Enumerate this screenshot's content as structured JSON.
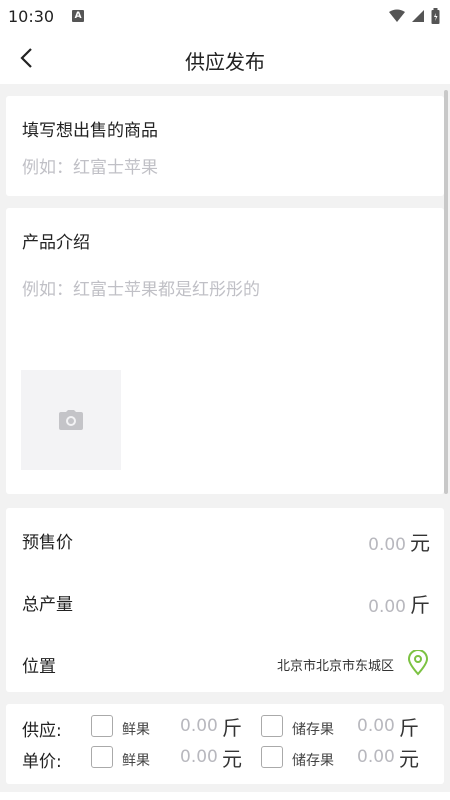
{
  "status": {
    "time": "10:30",
    "notif_letter": "A"
  },
  "nav": {
    "title": "供应发布"
  },
  "product": {
    "name_label": "填写想出售的商品",
    "name_placeholder": "例如：红富士苹果",
    "intro_label": "产品介绍",
    "intro_placeholder": "例如：红富士苹果都是红彤彤的"
  },
  "pricing": {
    "presale_label": "预售价",
    "presale_value": "0.00",
    "presale_unit": "元",
    "output_label": "总产量",
    "output_value": "0.00",
    "output_unit": "斤",
    "location_label": "位置",
    "location_value": "北京市北京市东城区"
  },
  "supply": {
    "supply_label": "供应:",
    "price_label": "单价:",
    "fresh_label": "鲜果",
    "stored_label": "储存果",
    "fresh_supply_value": "0.00",
    "fresh_supply_unit": "斤",
    "stored_supply_value": "0.00",
    "stored_supply_unit": "斤",
    "fresh_price_value": "0.00",
    "fresh_price_unit": "元",
    "stored_price_value": "0.00",
    "stored_price_unit": "元"
  },
  "colors": {
    "accent_green": "#7cc242",
    "placeholder": "#c0c0c6"
  }
}
